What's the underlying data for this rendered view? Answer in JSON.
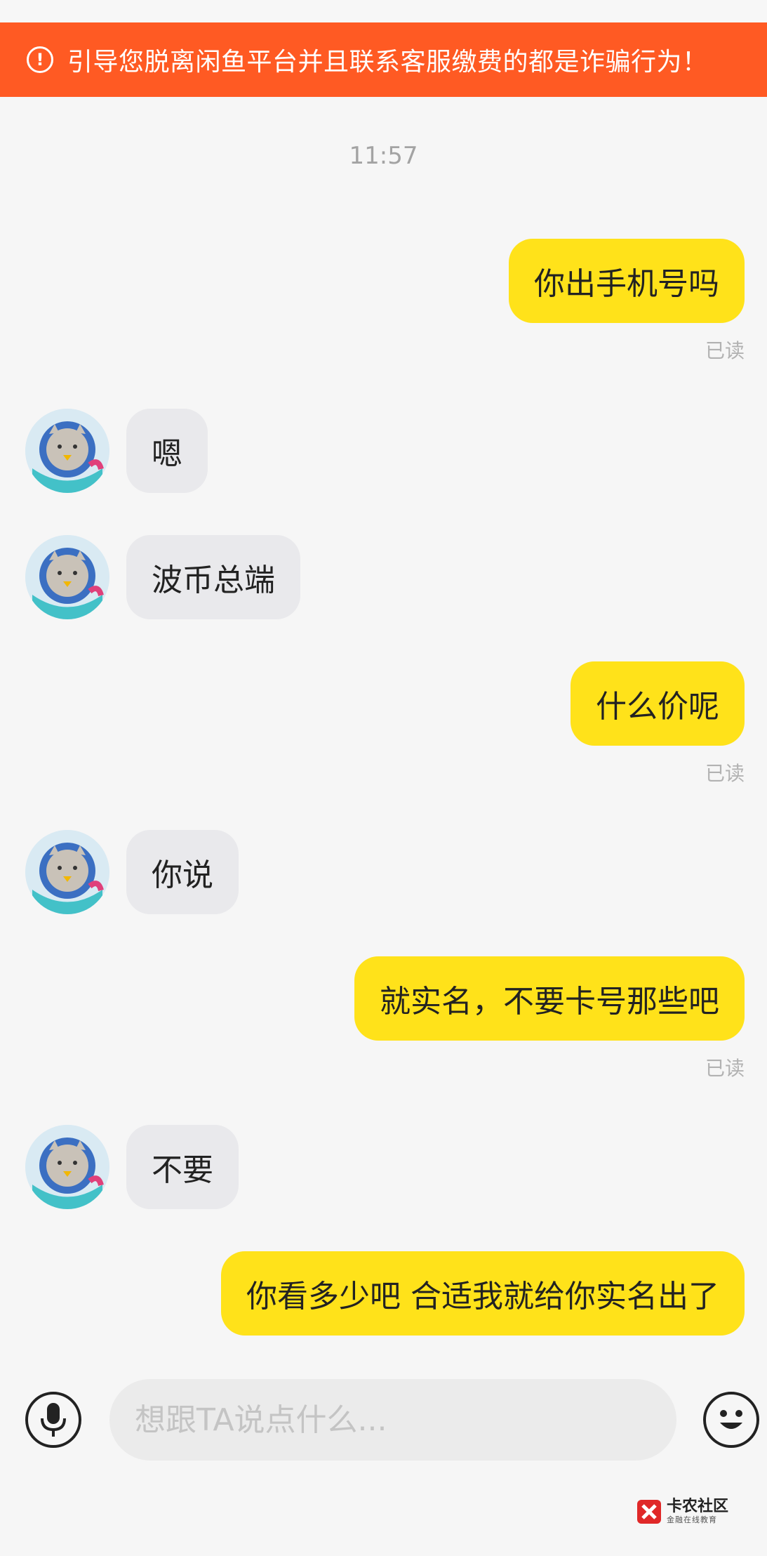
{
  "banner": {
    "icon": "exclamation-circle-icon",
    "text": "引导您脱离闲鱼平台并且联系客服缴费的都是诈骗行为！"
  },
  "chat": {
    "timestamp": "11:57",
    "messages": [
      {
        "side": "out",
        "text": "你出手机号吗",
        "status": "已读"
      },
      {
        "side": "in",
        "text": "嗯"
      },
      {
        "side": "in",
        "text": "波币总端"
      },
      {
        "side": "out",
        "text": "什么价呢",
        "status": "已读"
      },
      {
        "side": "in",
        "text": "你说"
      },
      {
        "side": "out",
        "text": "就实名，不要卡号那些吧",
        "status": "已读"
      },
      {
        "side": "in",
        "text": "不要"
      },
      {
        "side": "out",
        "text": "你看多少吧 合适我就给你实名出了"
      }
    ]
  },
  "composer": {
    "mic_icon": "microphone-icon",
    "placeholder": "想跟TA说点什么...",
    "emoji_icon": "smiley-face-icon"
  },
  "watermark": {
    "title": "卡农社区",
    "subtitle": "金融在线教育"
  },
  "colors": {
    "banner": "#ff5a23",
    "outgoing_bubble": "#ffe21a",
    "incoming_bubble": "#e9e9ec",
    "background": "#f6f6f6"
  }
}
